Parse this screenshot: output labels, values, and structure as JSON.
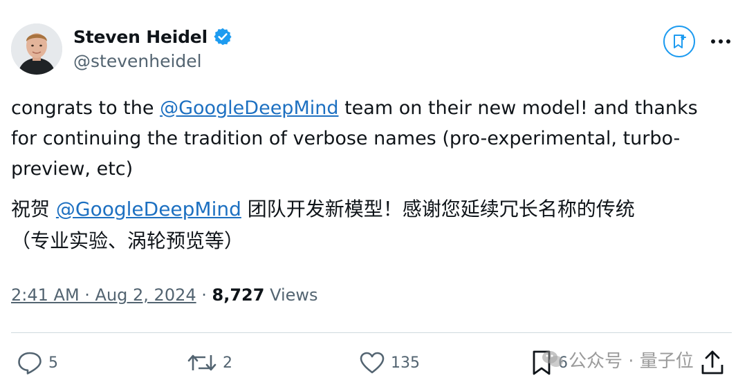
{
  "author": {
    "display_name": "Steven Heidel",
    "handle": "@stevenheidel",
    "verified": true
  },
  "tweet": {
    "en_lines": [
      {
        "before": "congrats to the ",
        "mention": "@GoogleDeepMind",
        "after": " team on their new model! and thanks"
      },
      {
        "text": "for continuing the tradition of verbose names (pro-experimental, turbo-"
      },
      {
        "text": "preview, etc)"
      }
    ],
    "zh_lines": [
      {
        "before": "祝贺 ",
        "mention": "@GoogleDeepMind",
        "after": " 团队开发新模型！感谢您延续冗长名称的传统"
      },
      {
        "text": "（专业实验、涡轮预览等）"
      }
    ]
  },
  "meta": {
    "timestamp": "2:41 AM · Aug 2, 2024",
    "separator": " · ",
    "views_count": "8,727",
    "views_label": "Views"
  },
  "actions": {
    "replies": "5",
    "reposts": "2",
    "likes": "135",
    "bookmarks": "6"
  },
  "watermark": {
    "text": "公众号 · 量子位"
  },
  "colors": {
    "accent": "#1d9bf0",
    "mention": "#1d70c1",
    "secondary_text": "#536471",
    "primary_text": "#0f1419",
    "divider": "#cfd9de"
  },
  "icons": {
    "verified": "verified-badge-icon",
    "bookmark": "bookmark-plus-icon",
    "more": "more-horizontal-icon",
    "reply": "reply-icon",
    "repost": "repost-icon",
    "like": "heart-icon",
    "bookmark_action": "bookmark-icon",
    "share": "share-icon",
    "watermark": "wechat-icon"
  }
}
